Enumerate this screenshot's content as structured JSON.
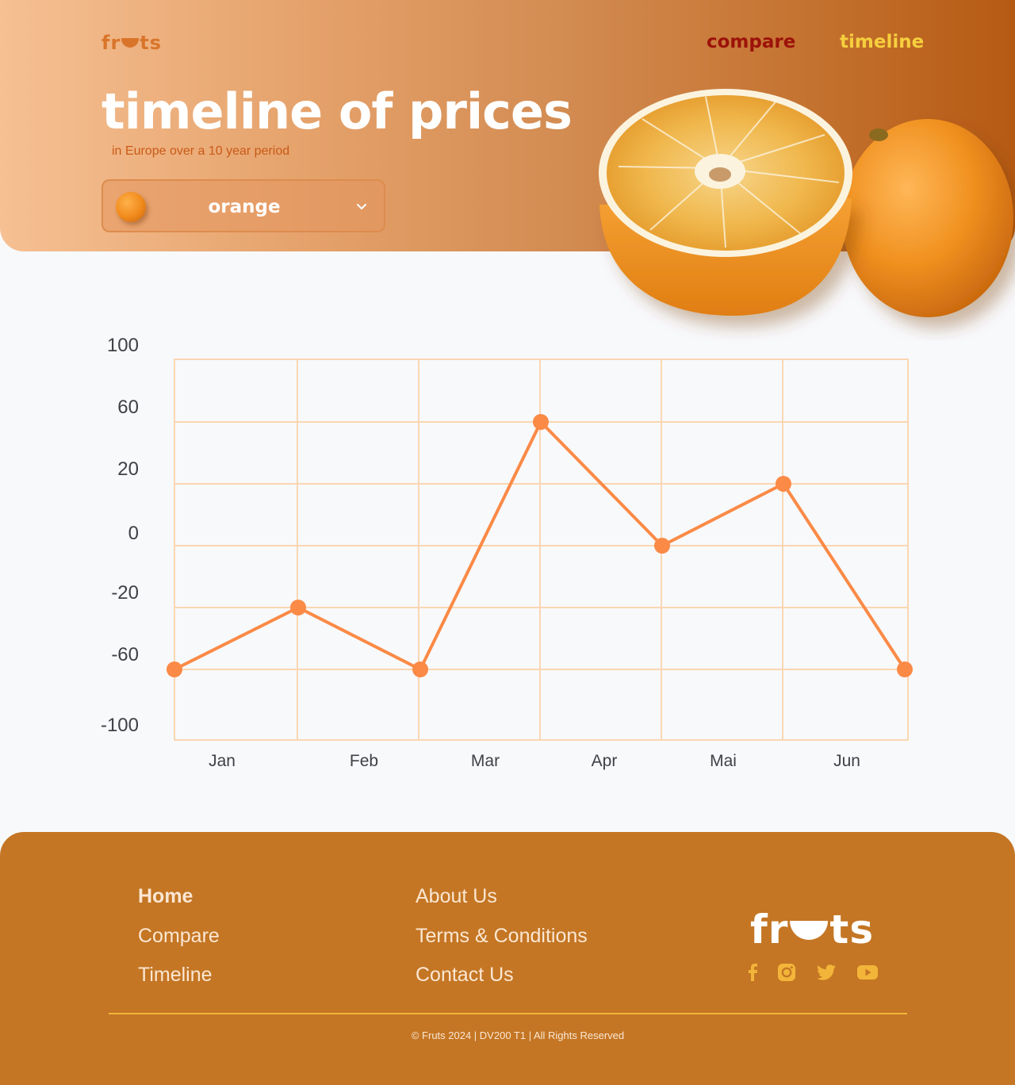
{
  "header": {
    "logo_text_start": "fr",
    "logo_text_end": "ts",
    "nav": {
      "compare": "compare",
      "timeline": "timeline"
    },
    "title": "timeline of prices",
    "subtitle": "in Europe over a 10 year period",
    "fruit_select": {
      "value": "orange",
      "icon": "orange-fruit-icon"
    }
  },
  "chart_data": {
    "type": "line",
    "categories": [
      "Jan",
      "Feb",
      "Mar",
      "Apr",
      "Mai",
      "Jun"
    ],
    "points": [
      -60,
      -20,
      -60,
      60,
      0,
      20,
      -60
    ],
    "y_tick_labels": [
      "100",
      "60",
      "20",
      "0",
      "-20",
      "-60",
      "-100"
    ],
    "grid": true,
    "color": "#fb8a46",
    "grid_color": "#fbd6b2"
  },
  "footer": {
    "col1": [
      "Home",
      "Compare",
      "Timeline"
    ],
    "col2": [
      "About Us",
      "Terms & Conditions",
      "Contact Us"
    ],
    "logo_text_start": "fr",
    "logo_text_end": "ts",
    "social": [
      "facebook-icon",
      "instagram-icon",
      "twitter-icon",
      "youtube-icon"
    ],
    "copyright": "© Fruts 2024 | DV200 T1 | All Rights Reserved"
  },
  "colors": {
    "accent": "#fb8a46",
    "footer": "#c47624",
    "nav_active": "#f6cf3e",
    "nav_inactive": "#9c1209"
  }
}
